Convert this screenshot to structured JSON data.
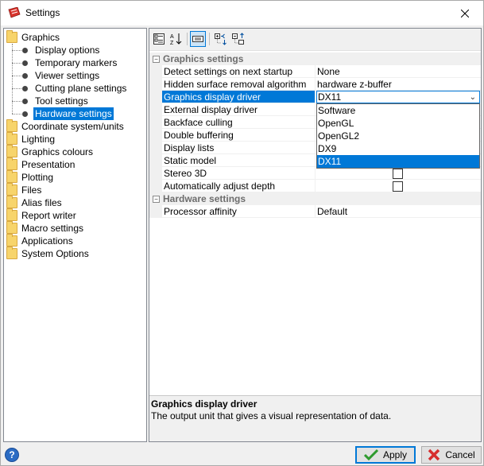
{
  "window": {
    "title": "Settings"
  },
  "tree": [
    {
      "label": "Graphics",
      "kind": "folder"
    },
    {
      "label": "Display options",
      "kind": "leaf"
    },
    {
      "label": "Temporary markers",
      "kind": "leaf"
    },
    {
      "label": "Viewer settings",
      "kind": "leaf"
    },
    {
      "label": "Cutting plane settings",
      "kind": "leaf"
    },
    {
      "label": "Tool settings",
      "kind": "leaf"
    },
    {
      "label": "Hardware settings",
      "kind": "leaf",
      "selected": true
    },
    {
      "label": "Coordinate system/units",
      "kind": "folder"
    },
    {
      "label": "Lighting",
      "kind": "folder"
    },
    {
      "label": "Graphics colours",
      "kind": "folder"
    },
    {
      "label": "Presentation",
      "kind": "folder"
    },
    {
      "label": "Plotting",
      "kind": "folder"
    },
    {
      "label": "Files",
      "kind": "folder"
    },
    {
      "label": "Alias files",
      "kind": "folder"
    },
    {
      "label": "Report writer",
      "kind": "folder"
    },
    {
      "label": "Macro settings",
      "kind": "folder"
    },
    {
      "label": "Applications",
      "kind": "folder"
    },
    {
      "label": "System Options",
      "kind": "folder"
    }
  ],
  "toolbar": {
    "buttons": [
      {
        "name": "categorized-view-button",
        "icon": "categorized-icon"
      },
      {
        "name": "alphabetical-sort-button",
        "icon": "sort-az-icon"
      },
      {
        "name": "property-pages-button",
        "icon": "property-pages-icon",
        "active": true
      },
      {
        "name": "expand-all-button",
        "icon": "expand-all-icon"
      },
      {
        "name": "collapse-all-button",
        "icon": "collapse-all-icon"
      }
    ]
  },
  "grid": {
    "categories": [
      {
        "title": "Graphics settings",
        "toggle": "−",
        "properties": [
          {
            "name": "Detect settings on next startup",
            "value": "None",
            "type": "text"
          },
          {
            "name": "Hidden surface removal algorithm",
            "value": "hardware z-buffer",
            "type": "text"
          },
          {
            "name": "Graphics display driver",
            "value": "DX11",
            "type": "combo",
            "selected": true
          },
          {
            "name": "External display driver",
            "value": "",
            "type": "text"
          },
          {
            "name": "Backface culling",
            "value": "",
            "type": "text"
          },
          {
            "name": "Double buffering",
            "value": "",
            "type": "text"
          },
          {
            "name": "Display lists",
            "value": "",
            "type": "text"
          },
          {
            "name": "Static model",
            "value": "",
            "type": "text"
          },
          {
            "name": "Stereo 3D",
            "value": "",
            "type": "checkbox"
          },
          {
            "name": "Automatically adjust depth",
            "value": "",
            "type": "checkbox"
          }
        ]
      },
      {
        "title": "Hardware settings",
        "toggle": "−",
        "properties": [
          {
            "name": "Processor affinity",
            "value": "Default",
            "type": "text"
          }
        ]
      }
    ],
    "dropdown": {
      "options": [
        "Software",
        "OpenGL",
        "OpenGL2",
        "DX9",
        "DX11"
      ],
      "selected": "DX11"
    }
  },
  "description": {
    "title": "Graphics display driver",
    "text": "The output unit that gives a visual representation of data."
  },
  "buttons": {
    "help": "?",
    "apply": "Apply",
    "cancel": "Cancel"
  },
  "colors": {
    "selection": "#0078d7",
    "folder": "#f7d46b",
    "apply_check": "#2e9a2e",
    "cancel_x": "#d62d2d"
  }
}
